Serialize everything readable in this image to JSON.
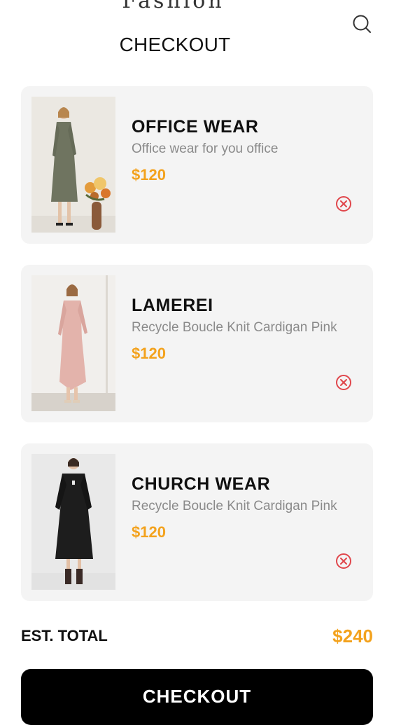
{
  "app": {
    "brand": "Fashion"
  },
  "header": {
    "title": "CHECKOUT",
    "search_icon": "search-icon"
  },
  "cart": {
    "items": [
      {
        "title": "OFFICE WEAR",
        "description": "Office wear for you office",
        "price": "$120"
      },
      {
        "title": "LAMEREI",
        "description": "Recycle Boucle Knit Cardigan Pink",
        "price": "$120"
      },
      {
        "title": "CHURCH WEAR",
        "description": "Recycle Boucle Knit Cardigan Pink",
        "price": "$120"
      }
    ],
    "remove_icon": "close-circle-icon"
  },
  "summary": {
    "label": "EST. TOTAL",
    "value": "$240"
  },
  "checkout": {
    "label": "CHECKOUT"
  },
  "colors": {
    "accent": "#f3a21d",
    "card_bg": "#f4f4f4",
    "remove": "#e0474c",
    "button_bg": "#000000"
  }
}
